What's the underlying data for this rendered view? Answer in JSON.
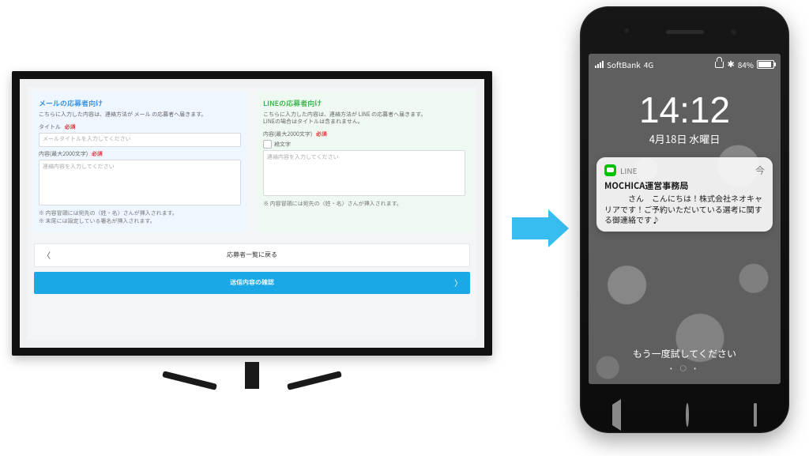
{
  "monitor": {
    "mail": {
      "heading": "メールの応募者向け",
      "desc": "こちらに入力した内容は、連絡方法が メール の応募者へ届きます。",
      "title_label": "タイトル",
      "required": "必須",
      "title_placeholder": "メールタイトルを入力してください",
      "body_label": "内容(最大2000文字)",
      "body_placeholder": "連絡内容を入力してください",
      "hint1": "※ 内容冒頭には宛先の〈姓・名〉さんが挿入されます。",
      "hint2": "※ 末尾には設定している署名が挿入されます。"
    },
    "line": {
      "heading": "LINEの応募者向け",
      "desc1": "こちらに入力した内容は、連絡方法が LINE の応募者へ届きます。",
      "desc2": "LINEの場合はタイトルは含まれません。",
      "body_label": "内容(最大2000文字)",
      "required": "必須",
      "etsubun": "絵文字",
      "body_placeholder": "連絡内容を入力してください",
      "hint": "※ 内容冒頭には宛先の〈姓・名〉さんが挿入されます。"
    },
    "back": "応募者一覧に戻る",
    "confirm": "送信内容の確認"
  },
  "phone": {
    "carrier": "SoftBank",
    "net": "4G",
    "battery": "84%",
    "time": "14:12",
    "date": "4月18日 水曜日",
    "notif": {
      "app": "LINE",
      "when": "今",
      "title": "MOCHICA運営事務局",
      "body": "　　　さん　こんにちは！株式会社ネオキャリアです！ご予約いただいている選考に関する御連絡です♪"
    },
    "retry": "もう一度試してください"
  }
}
